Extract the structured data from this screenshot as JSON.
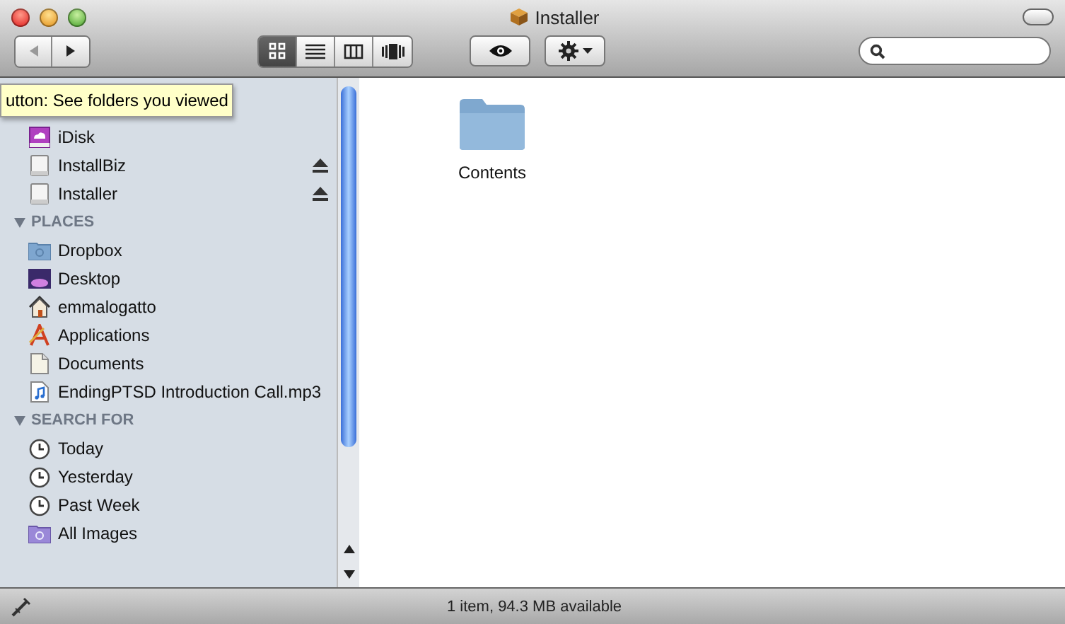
{
  "window": {
    "title": "Installer"
  },
  "toolbar": {
    "views": [
      {
        "kind": "icon",
        "selected": true
      },
      {
        "kind": "list",
        "selected": false
      },
      {
        "kind": "columns",
        "selected": false
      },
      {
        "kind": "coverflow",
        "selected": false
      }
    ]
  },
  "tooltip": "utton: See folders you viewed",
  "sidebar": {
    "sections": [
      {
        "items": [
          {
            "label": "iDisk",
            "kind": "idisk",
            "eject": false
          },
          {
            "label": "InstallBiz",
            "kind": "drive",
            "eject": true
          },
          {
            "label": "Installer",
            "kind": "drive",
            "eject": true
          }
        ]
      },
      {
        "title": "PLACES",
        "items": [
          {
            "label": "Dropbox",
            "kind": "folder",
            "eject": false
          },
          {
            "label": "Desktop",
            "kind": "desktop",
            "eject": false
          },
          {
            "label": "emmalogatto",
            "kind": "home",
            "eject": false
          },
          {
            "label": "Applications",
            "kind": "apps",
            "eject": false
          },
          {
            "label": "Documents",
            "kind": "doc",
            "eject": false
          },
          {
            "label": "EndingPTSD Introduction Call.mp3",
            "kind": "audio",
            "eject": false
          }
        ]
      },
      {
        "title": "SEARCH FOR",
        "items": [
          {
            "label": "Today",
            "kind": "clock",
            "eject": false
          },
          {
            "label": "Yesterday",
            "kind": "clock",
            "eject": false
          },
          {
            "label": "Past Week",
            "kind": "clock",
            "eject": false
          },
          {
            "label": "All Images",
            "kind": "smartfolder",
            "eject": false
          }
        ]
      }
    ]
  },
  "files": [
    {
      "label": "Contents"
    }
  ],
  "status_bar": "1 item, 94.3 MB available"
}
